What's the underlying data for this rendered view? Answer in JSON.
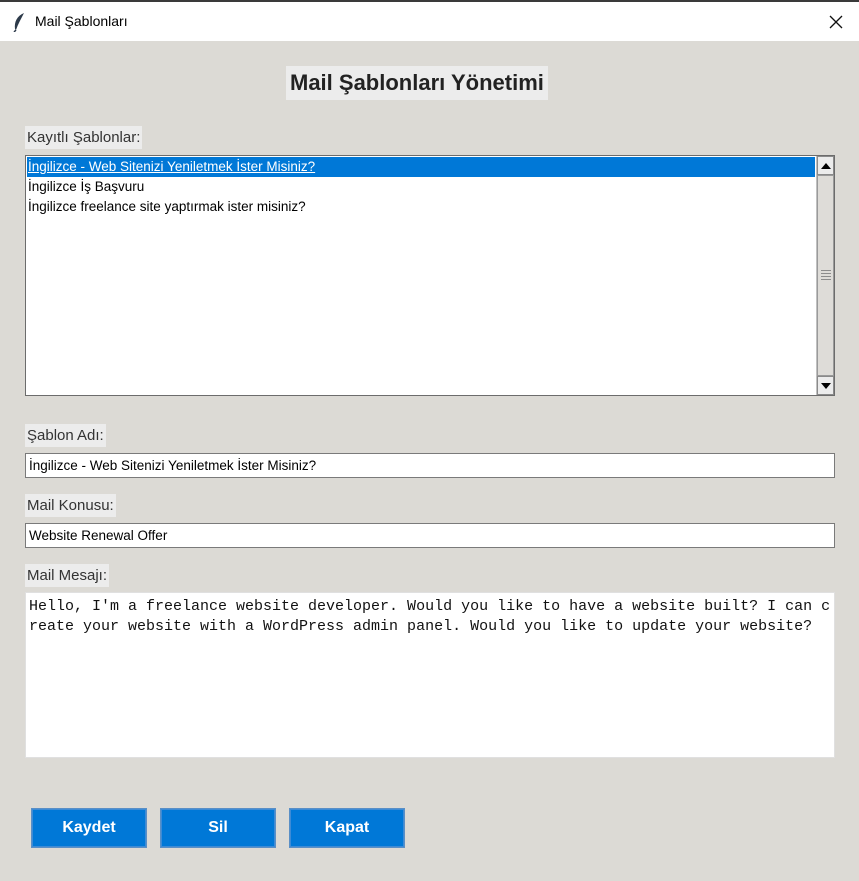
{
  "window": {
    "title": "Mail Şablonları",
    "icon": "feather-icon"
  },
  "heading": "Mail Şablonları Yönetimi",
  "templates_section": {
    "label": "Kayıtlı Şablonlar:",
    "items": [
      "İngilizce - Web Sitenizi Yeniletmek İster Misiniz?",
      "İngilizce İş Başvuru",
      "İngilizce freelance site yaptırmak ister misiniz?"
    ],
    "selected_index": 0
  },
  "form": {
    "name_label": "Şablon Adı:",
    "name_value": "İngilizce - Web Sitenizi Yeniletmek İster Misiniz?",
    "subject_label": "Mail Konusu:",
    "subject_value": "Website Renewal Offer",
    "message_label": "Mail Mesajı:",
    "message_value": "Hello, I'm a freelance website developer. Would you like to have a website built? I can create your website with a WordPress admin panel. Would you like to update your website?"
  },
  "buttons": {
    "save": "Kaydet",
    "delete": "Sil",
    "close": "Kapat"
  },
  "colors": {
    "accent": "#0078d7",
    "background": "#dcdad5"
  }
}
